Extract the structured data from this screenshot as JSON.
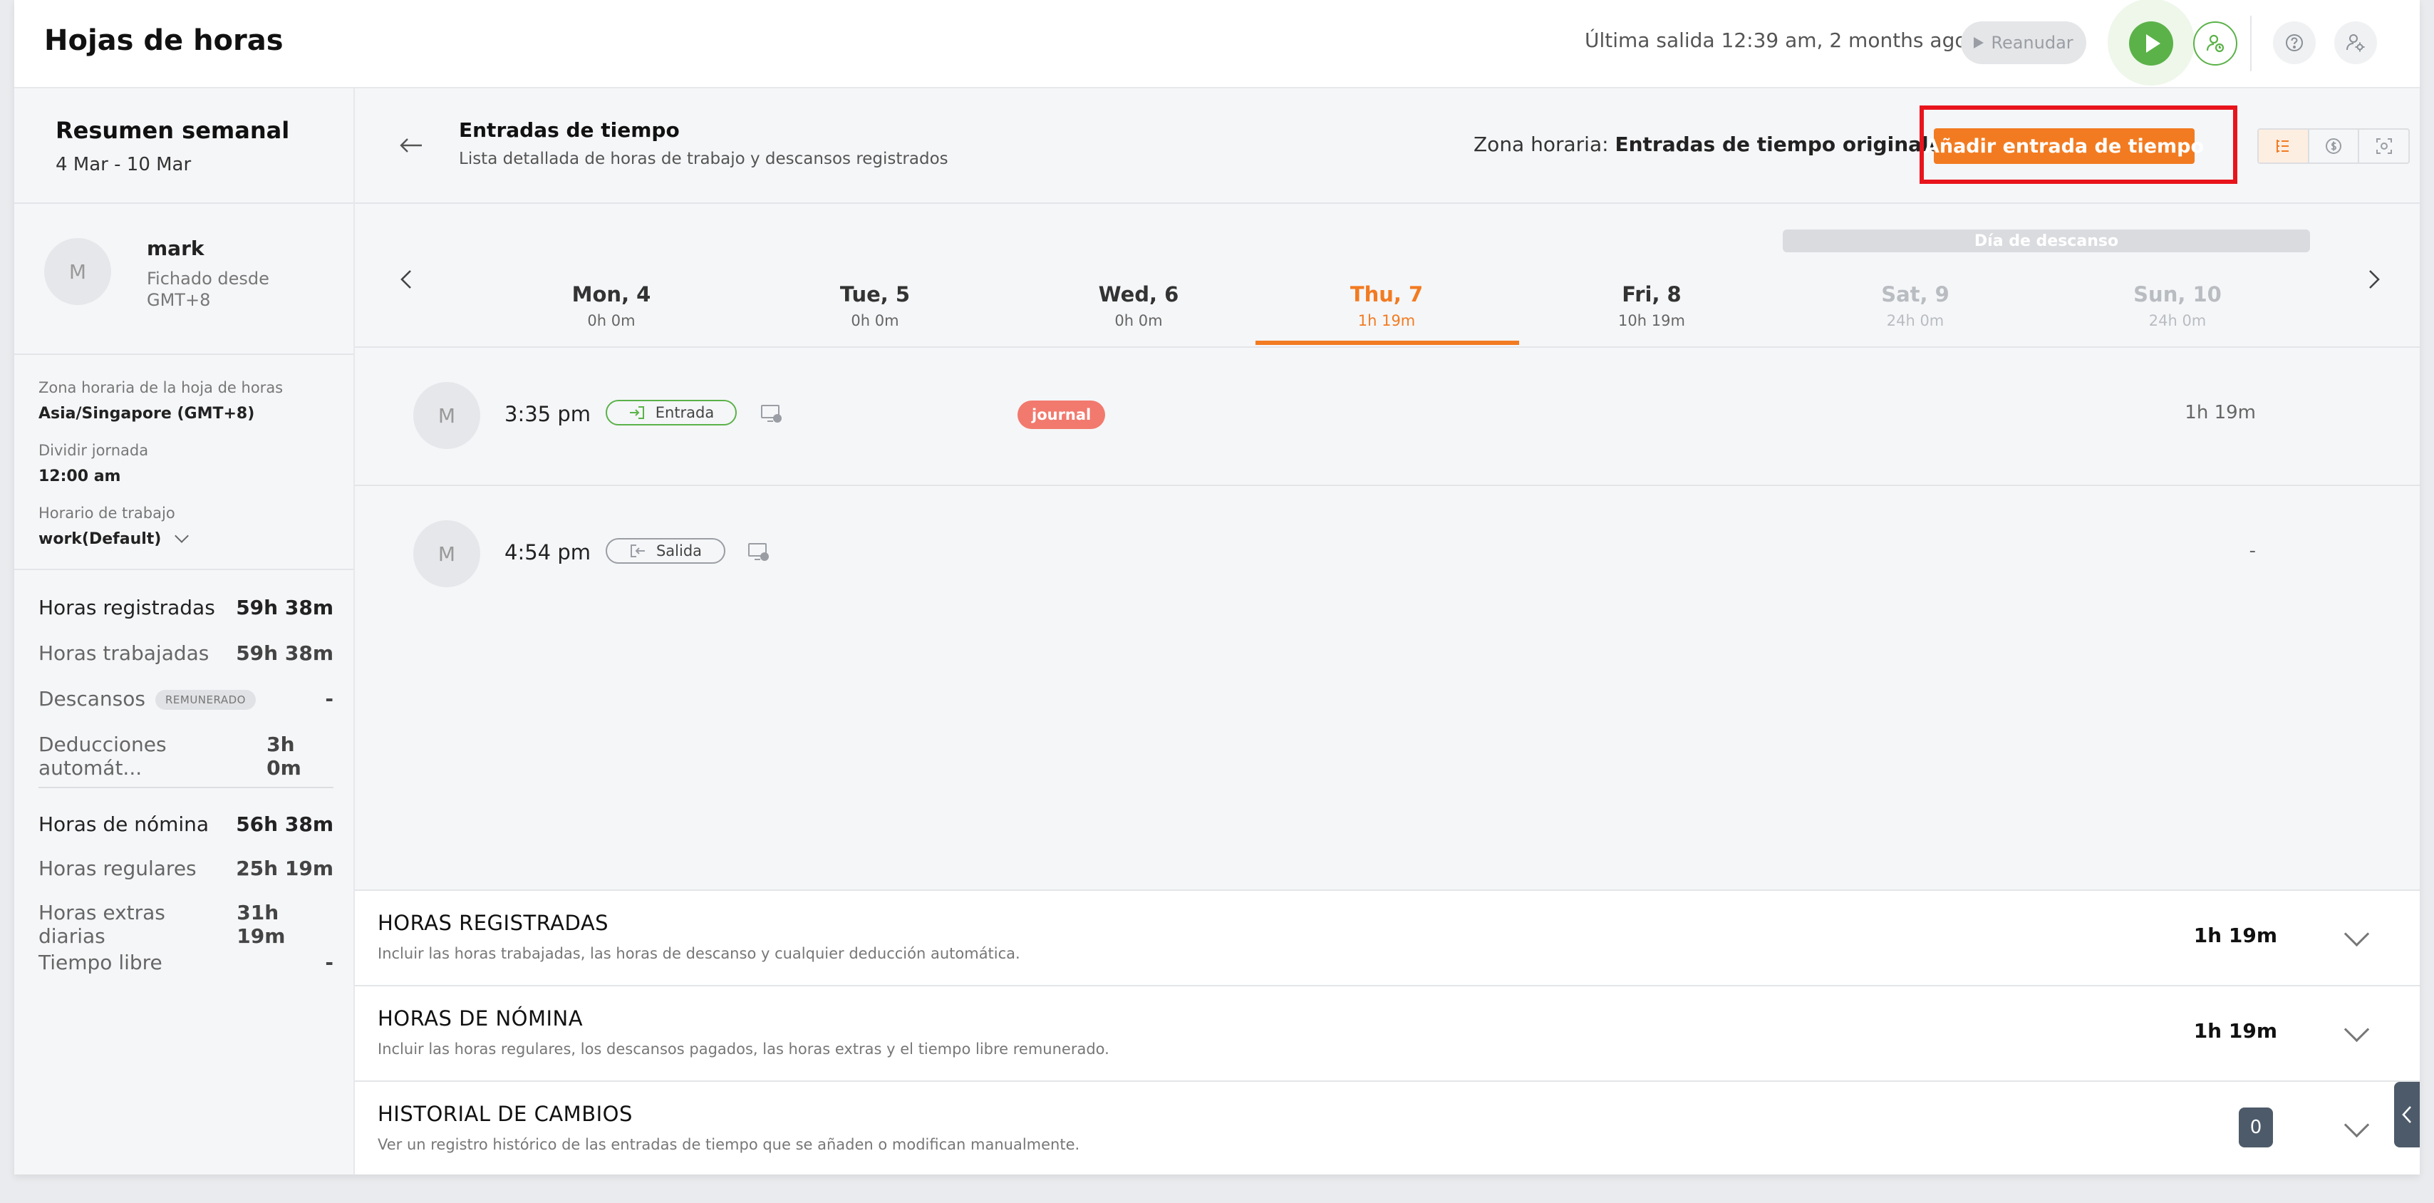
{
  "header": {
    "title": "Hojas de horas",
    "last_out": "Última salida 12:39 am, 2 months ago",
    "resume_label": "Reanudar"
  },
  "sidebar": {
    "summary_title": "Resumen semanal",
    "summary_range": "4 Mar - 10 Mar",
    "user": {
      "initial": "M",
      "name": "mark",
      "status_line1": "Fichado desde",
      "status_line2": "GMT+8"
    },
    "settings": {
      "timezone_label": "Zona horaria de la hoja de horas",
      "timezone_value": "Asia/Singapore (GMT+8)",
      "split_label": "Dividir jornada",
      "split_value": "12:00 am",
      "schedule_label": "Horario de trabajo",
      "schedule_value": "work(Default)"
    },
    "stats": [
      {
        "label": "Horas registradas",
        "value": "59h 38m"
      },
      {
        "label": "Horas trabajadas",
        "value": "59h 38m"
      },
      {
        "label": "Descansos",
        "badge": "REMUNERADO",
        "value": "-"
      },
      {
        "label": "Deducciones automát...",
        "value": "3h 0m"
      }
    ],
    "payroll": [
      {
        "label": "Horas de nómina",
        "value": "56h 38m"
      },
      {
        "label": "Horas regulares",
        "value": "25h 19m"
      },
      {
        "label": "Horas extras diarias",
        "value": "31h 19m"
      },
      {
        "label": "Tiempo libre",
        "value": "-"
      }
    ]
  },
  "time_entries": {
    "title": "Entradas de tiempo",
    "subtitle": "Lista detallada de horas de trabajo y descansos registrados",
    "timezone_label": "Zona horaria:",
    "timezone_value": "Entradas de tiempo originales",
    "add_button": "Añadir entrada de tiempo",
    "rest_day_label": "Día de descanso",
    "days": [
      {
        "name": "Mon, 4",
        "hours": "0h 0m",
        "state": "normal"
      },
      {
        "name": "Tue, 5",
        "hours": "0h 0m",
        "state": "normal"
      },
      {
        "name": "Wed, 6",
        "hours": "0h 0m",
        "state": "normal"
      },
      {
        "name": "Thu, 7",
        "hours": "1h 19m",
        "state": "selected"
      },
      {
        "name": "Fri, 8",
        "hours": "10h 19m",
        "state": "normal"
      },
      {
        "name": "Sat, 9",
        "hours": "24h 0m",
        "state": "rest"
      },
      {
        "name": "Sun, 10",
        "hours": "24h 0m",
        "state": "rest"
      }
    ],
    "entries": [
      {
        "initial": "M",
        "time": "3:35 pm",
        "type": "Entrada",
        "tag": "journal",
        "duration": "1h 19m"
      },
      {
        "initial": "M",
        "time": "4:54 pm",
        "type": "Salida",
        "duration": "-"
      }
    ]
  },
  "sections": [
    {
      "title": "HORAS REGISTRADAS",
      "subtitle": "Incluir las horas trabajadas, las horas de descanso y cualquier deducción automática.",
      "value": "1h 19m"
    },
    {
      "title": "HORAS DE NÓMINA",
      "subtitle": "Incluir las horas regulares, los descansos pagados, las horas extras y el tiempo libre remunerado.",
      "value": "1h 19m"
    },
    {
      "title": "HISTORIAL DE CAMBIOS",
      "subtitle": "Ver un registro histórico de las entradas de tiempo que se añaden o modifican manualmente.",
      "count": "0"
    }
  ],
  "colors": {
    "accent": "#f27b21",
    "green": "#5bb249",
    "highlight_box": "#e8141c",
    "tag": "#f2796d"
  },
  "icons": [
    "play-icon",
    "user-clock-icon",
    "help-icon",
    "settings-user-icon",
    "back-arrow-icon",
    "list-view-icon",
    "dollar-view-icon",
    "screenshot-view-icon",
    "chevron-left-icon",
    "chevron-right-icon",
    "clock-in-icon",
    "clock-out-icon",
    "device-icon",
    "chevron-down-icon"
  ]
}
